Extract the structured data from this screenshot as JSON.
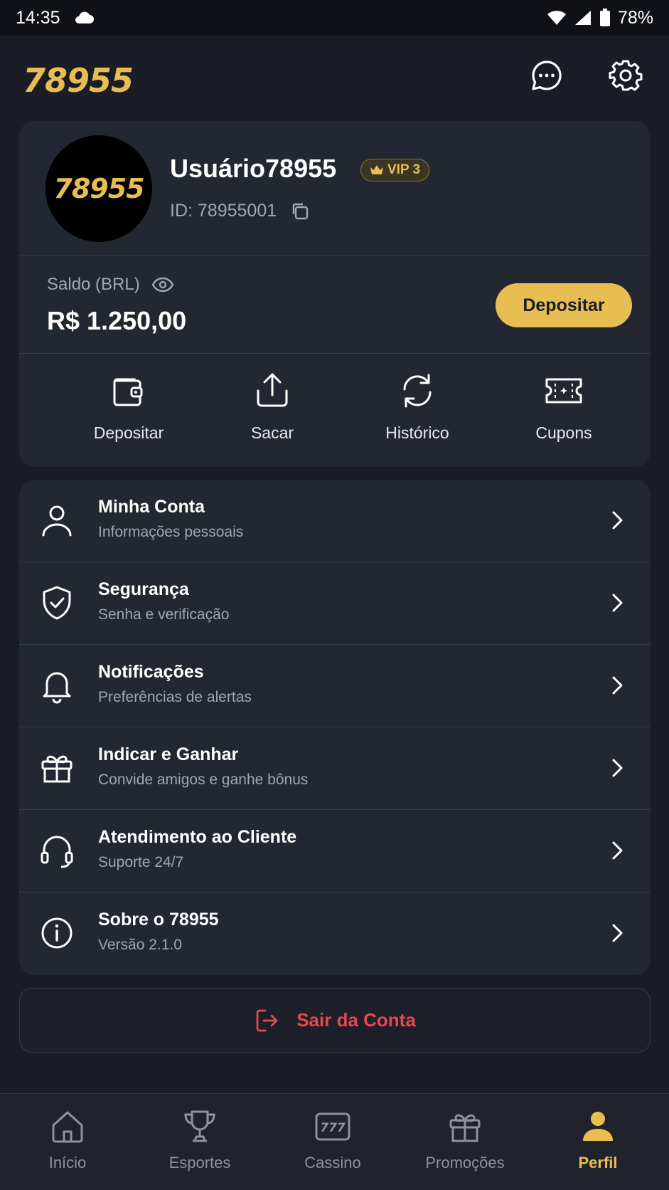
{
  "status_bar": {
    "time": "14:35",
    "battery": "78%"
  },
  "header": {
    "logo": "78955"
  },
  "profile": {
    "avatar_text": "78955",
    "username": "Usuário78955",
    "vip_badge": "VIP 3",
    "user_id": "ID: 78955001"
  },
  "balance": {
    "label": "Saldo (BRL)",
    "value": "R$ 1.250,00",
    "deposit_button": "Depositar"
  },
  "quick_actions": [
    {
      "label": "Depositar",
      "icon": "wallet-icon"
    },
    {
      "label": "Sacar",
      "icon": "upload-icon"
    },
    {
      "label": "Histórico",
      "icon": "refresh-icon"
    },
    {
      "label": "Cupons",
      "icon": "ticket-icon"
    }
  ],
  "menu": [
    {
      "title": "Minha Conta",
      "subtitle": "Informações pessoais",
      "icon": "user-icon"
    },
    {
      "title": "Segurança",
      "subtitle": "Senha e verificação",
      "icon": "shield-icon"
    },
    {
      "title": "Notificações",
      "subtitle": "Preferências de alertas",
      "icon": "bell-icon"
    },
    {
      "title": "Indicar e Ganhar",
      "subtitle": "Convide amigos e ganhe bônus",
      "icon": "gift-icon"
    },
    {
      "title": "Atendimento ao Cliente",
      "subtitle": "Suporte 24/7",
      "icon": "headset-icon"
    },
    {
      "title": "Sobre o 78955",
      "subtitle": "Versão 2.1.0",
      "icon": "info-icon"
    }
  ],
  "logout": {
    "label": "Sair da Conta"
  },
  "bottom_nav": [
    {
      "label": "Início",
      "icon": "home-icon"
    },
    {
      "label": "Esportes",
      "icon": "trophy-icon"
    },
    {
      "label": "Cassino",
      "icon": "slot-machine-icon"
    },
    {
      "label": "Promoções",
      "icon": "gift-icon"
    },
    {
      "label": "Perfil",
      "icon": "person-icon",
      "active": true
    }
  ],
  "colors": {
    "accent": "#e8bd52",
    "background": "#1a1d25",
    "card": "#232732",
    "danger": "#e5484d"
  }
}
